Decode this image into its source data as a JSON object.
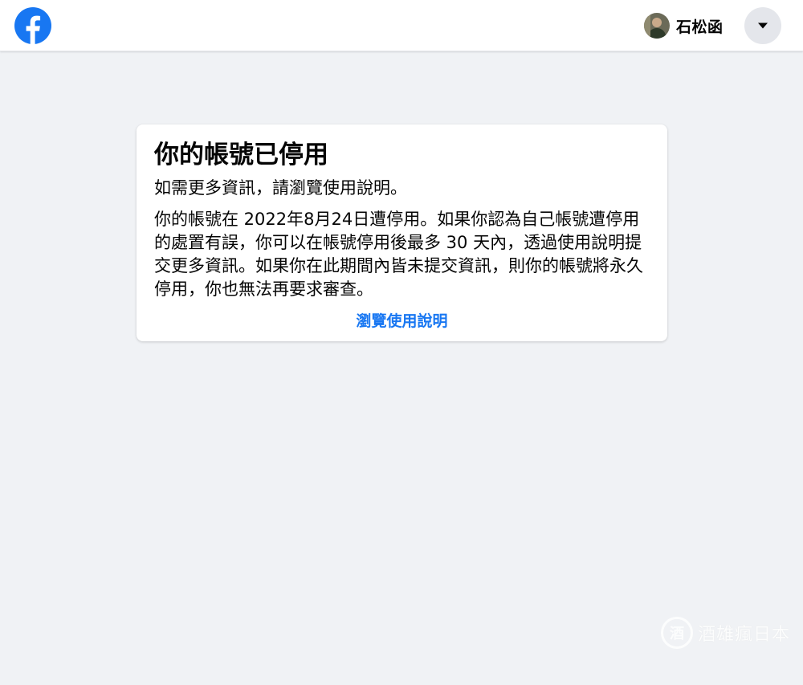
{
  "header": {
    "logo_icon": "facebook-logo-icon",
    "brand_color": "#1877f2",
    "profile": {
      "avatar_icon": "user-avatar",
      "name": "石松函"
    },
    "menu_icon": "caret-down-icon"
  },
  "notice": {
    "title": "你的帳號已停用",
    "subtitle": "如需更多資訊，請瀏覽使用說明。",
    "body": "你的帳號在 2022年8月24日遭停用。如果你認為自己帳號遭停用的處置有誤，你可以在帳號停用後最多 30 天內，透過使用說明提交更多資訊。如果你在此期間內皆未提交資訊，則你的帳號將永久停用，你也無法再要求審查。",
    "link_label": "瀏覽使用說明"
  },
  "watermark": {
    "badge": "酒",
    "text": "酒雄瘋日本"
  }
}
